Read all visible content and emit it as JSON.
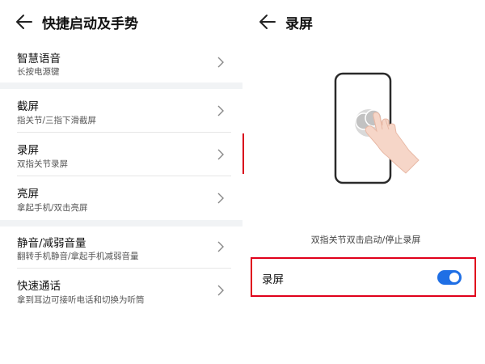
{
  "left_panel": {
    "title": "快捷启动及手势",
    "items": [
      {
        "title": "智慧语音",
        "subtitle": "长按电源键"
      },
      {
        "title": "截屏",
        "subtitle": "指关节/三指下滑截屏"
      },
      {
        "title": "录屏",
        "subtitle": "双指关节录屏"
      },
      {
        "title": "亮屏",
        "subtitle": "拿起手机/双击亮屏"
      },
      {
        "title": "静音/减弱音量",
        "subtitle": "翻转手机静音/拿起手机减弱音量"
      },
      {
        "title": "快速通话",
        "subtitle": "拿到耳边可接听电话和切换为听筒"
      }
    ]
  },
  "right_panel": {
    "title": "录屏",
    "caption": "双指关节双击启动/停止录屏",
    "setting": {
      "label": "录屏",
      "enabled": true
    }
  },
  "colors": {
    "accent": "#1f6fe5",
    "highlight_border": "#e0001b",
    "section_gap": "#f1f3f5"
  },
  "icons": [
    "back-arrow-icon",
    "chevron-right-icon",
    "phone-gesture-illustration"
  ]
}
